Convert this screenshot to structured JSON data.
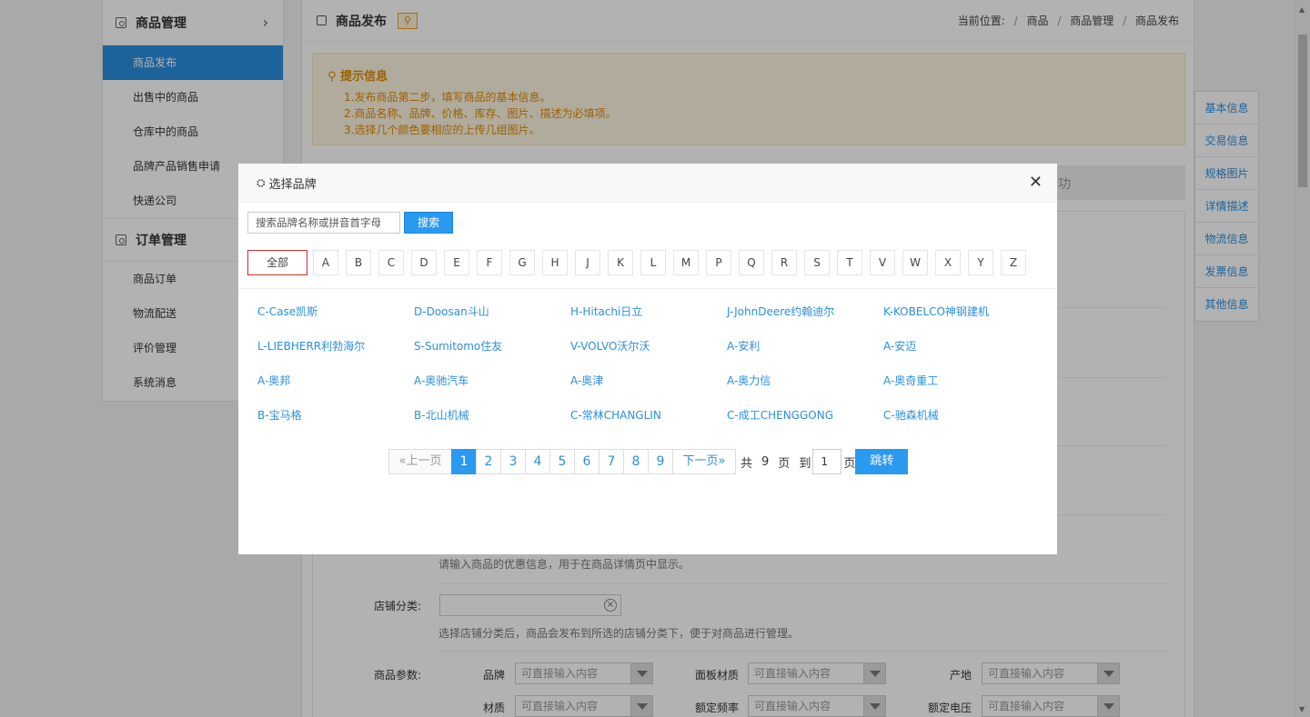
{
  "sidebar": {
    "goods_header": "商品管理",
    "goods_items": [
      "商品发布",
      "出售中的商品",
      "仓库中的商品",
      "品牌产品销售申请",
      "快递公司"
    ],
    "orders_header": "订单管理",
    "order_items": [
      "商品订单",
      "物流配送",
      "评价管理",
      "系统消息"
    ]
  },
  "page": {
    "title": "商品发布",
    "breadcrumb": {
      "prefix": "当前位置:",
      "items": [
        "商品",
        "商品管理",
        "商品发布"
      ]
    },
    "tips_title": "提示信息",
    "tips": [
      "1.发布商品第二步，填写商品的基本信息。",
      "2.商品名称、品牌、价格、库存、图片、描述为必填项。",
      "3.选择几个颜色要相应的上传几组图片。"
    ],
    "step_text": "功",
    "promo_hint": "请输入商品的优惠信息，用于在商品详情页中显示。",
    "shop_category_label": "店铺分类:",
    "shop_category_hint": "选择店铺分类后，商品会发布到所选的店铺分类下，便于对商品进行管理。",
    "params_label": "商品参数:",
    "params": [
      {
        "label": "品牌",
        "placeholder": "可直接输入内容"
      },
      {
        "label": "面板材质",
        "placeholder": "可直接输入内容"
      },
      {
        "label": "产地",
        "placeholder": "可直接输入内容"
      },
      {
        "label": "材质",
        "placeholder": "可直接输入内容"
      },
      {
        "label": "额定频率",
        "placeholder": "可直接输入内容"
      },
      {
        "label": "额定电压",
        "placeholder": "可直接输入内容"
      }
    ]
  },
  "right_tabs": [
    "基本信息",
    "交易信息",
    "规格图片",
    "详情描述",
    "物流信息",
    "发票信息",
    "其他信息"
  ],
  "modal": {
    "title": "选择品牌",
    "search_placeholder": "搜索品牌名称或拼音首字母",
    "search_button": "搜索",
    "all_label": "全部",
    "letters": [
      "A",
      "B",
      "C",
      "D",
      "E",
      "F",
      "G",
      "H",
      "J",
      "K",
      "L",
      "M",
      "P",
      "Q",
      "R",
      "S",
      "T",
      "V",
      "W",
      "X",
      "Y",
      "Z"
    ],
    "brands": [
      [
        "C-Case凯斯",
        "D-Doosan斗山",
        "H-Hitachi日立",
        "J-JohnDeere约翰迪尔",
        "K-KOBELCO神钢建机"
      ],
      [
        "L-LIEBHERR利勃海尔",
        "S-Sumitomo住友",
        "V-VOLVO沃尔沃",
        "A-安利",
        "A-安迈"
      ],
      [
        "A-奥邦",
        "A-奥驰汽车",
        "A-奥津",
        "A-奥力信",
        "A-奥奇重工"
      ],
      [
        "B-宝马格",
        "B-北山机械",
        "C-常林CHANGLIN",
        "C-成工CHENGGONG",
        "C-驰森机械"
      ]
    ],
    "pager": {
      "prev": "«上一页",
      "pages": [
        "1",
        "2",
        "3",
        "4",
        "5",
        "6",
        "7",
        "8",
        "9"
      ],
      "current": "1",
      "next": "下一页»",
      "total_prefix": "共",
      "total": "9",
      "total_suffix": "页",
      "to": "到",
      "input_value": "1",
      "page_unit": "页",
      "jump": "跳转"
    }
  }
}
